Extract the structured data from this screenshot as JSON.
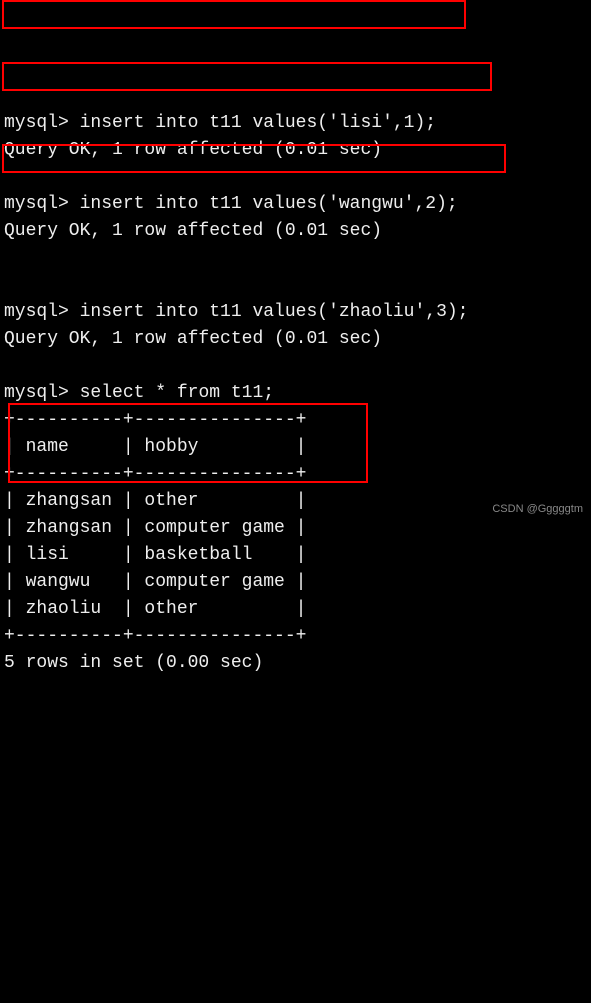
{
  "commands": [
    {
      "prompt": "mysql>",
      "statement": "insert into t11 values('lisi',1);",
      "result": "Query OK, 1 row affected (0.01 sec)"
    },
    {
      "prompt": "mysql>",
      "statement": "insert into t11 values('wangwu',2);",
      "result": "Query OK, 1 row affected (0.01 sec)"
    },
    {
      "prompt": "mysql>",
      "statement": "insert into t11 values('zhaoliu',3);",
      "result": "Query OK, 1 row affected (0.01 sec)"
    }
  ],
  "select": {
    "prompt": "mysql>",
    "statement": "select * from t11;",
    "table": {
      "divider": "+----------+---------------+",
      "headers": [
        "name",
        "hobby"
      ],
      "header_row": "| name     | hobby         |",
      "rows": [
        {
          "name": "zhangsan",
          "hobby": "other",
          "line": "| zhangsan | other         |"
        },
        {
          "name": "zhangsan",
          "hobby": "computer game",
          "line": "| zhangsan | computer game |"
        },
        {
          "name": "lisi",
          "hobby": "basketball",
          "line": "| lisi     | basketball    |"
        },
        {
          "name": "wangwu",
          "hobby": "computer game",
          "line": "| wangwu   | computer game |"
        },
        {
          "name": "zhaoliu",
          "hobby": "other",
          "line": "| zhaoliu  | other         |"
        }
      ]
    },
    "footer": "5 rows in set (0.00 sec)"
  },
  "watermark": "CSDN @Gggggtm"
}
